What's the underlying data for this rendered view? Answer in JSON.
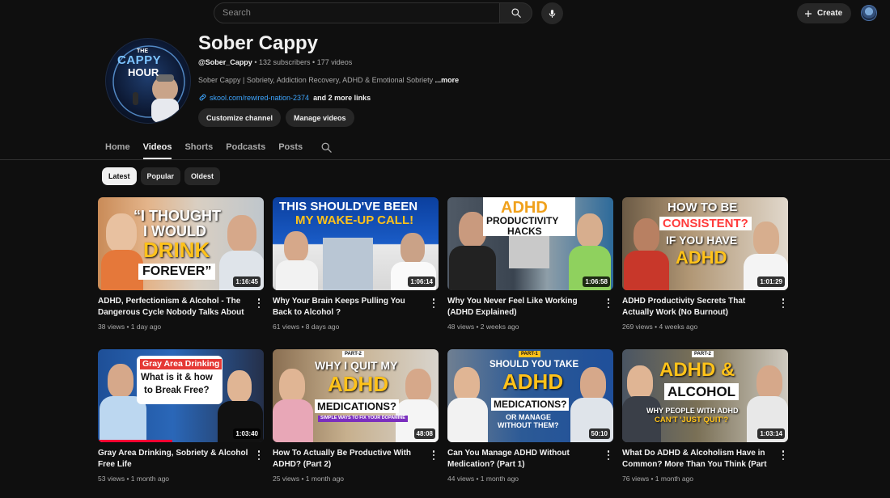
{
  "search": {
    "placeholder": "Search"
  },
  "header": {
    "create_label": "Create"
  },
  "channel": {
    "name": "Sober Cappy",
    "handle": "@Sober_Cappy",
    "subscribers": "132 subscribers",
    "videos_count": "177 videos",
    "description": "Sober Cappy | Sobriety, Addiction Recovery, ADHD & Emotional Sobriety",
    "description_more": "...more",
    "link": "skool.com/rewired-nation-2374",
    "more_links": "and 2 more links",
    "customize_label": "Customize channel",
    "manage_label": "Manage videos",
    "avatar_text": [
      "THE",
      "CAPPY",
      "HOUR"
    ]
  },
  "tabs": [
    "Home",
    "Videos",
    "Shorts",
    "Podcasts",
    "Posts"
  ],
  "active_tab": "Videos",
  "filters": [
    "Latest",
    "Popular",
    "Oldest"
  ],
  "active_filter": "Latest",
  "colors": {
    "accent_red": "#ff0033",
    "link_blue": "#3ea6ff",
    "background": "#0f0f0f"
  },
  "videos": [
    {
      "title": "ADHD, Perfectionism & Alcohol - The Dangerous Cycle Nobody Talks About",
      "views": "38 views",
      "age": "1 day ago",
      "duration": "1:16:45",
      "thumb_text": [
        "“I THOUGHT",
        "I WOULD",
        "DRINK",
        "FOREVER”"
      ]
    },
    {
      "title": "Why Your Brain Keeps Pulling You Back to Alcohol ?",
      "views": "61 views",
      "age": "8 days ago",
      "duration": "1:06:14",
      "thumb_text": [
        "THIS SHOULD'VE BEEN",
        "MY WAKE-UP CALL!"
      ]
    },
    {
      "title": "Why You Never Feel Like Working (ADHD Explained)",
      "views": "48 views",
      "age": "2 weeks ago",
      "duration": "1:06:58",
      "thumb_text": [
        "ADHD",
        "PRODUCTIVITY",
        "HACKS"
      ]
    },
    {
      "title": "ADHD Productivity Secrets That Actually Work (No Burnout)",
      "views": "269 views",
      "age": "4 weeks ago",
      "duration": "1:01:29",
      "thumb_text": [
        "HOW TO BE",
        "CONSISTENT?",
        "IF YOU HAVE",
        "ADHD"
      ]
    },
    {
      "title": "Gray Area Drinking, Sobriety & Alcohol Free Life",
      "views": "53 views",
      "age": "1 month ago",
      "duration": "1:03:40",
      "thumb_text": [
        "Gray Area Drinking",
        "What is it & how",
        "to Break Free?"
      ]
    },
    {
      "title": "How To Actually Be Productive With ADHD? (Part 2)",
      "views": "25 views",
      "age": "1 month ago",
      "duration": "48:08",
      "thumb_text": [
        "PART-2",
        "WHY I QUIT MY",
        "ADHD",
        "MEDICATIONS?",
        "SIMPLE WAYS TO FIX YOUR DOPAMINE"
      ]
    },
    {
      "title": "Can You Manage ADHD Without Medication? (Part 1)",
      "views": "44 views",
      "age": "1 month ago",
      "duration": "50:10",
      "thumb_text": [
        "PART-1",
        "SHOULD YOU TAKE",
        "ADHD",
        "MEDICATIONS?",
        "OR MANAGE",
        "WITHOUT THEM?"
      ]
    },
    {
      "title": "What Do ADHD & Alcoholism Have in Common? More Than You Think (Part ...",
      "views": "76 views",
      "age": "1 month ago",
      "duration": "1:03:14",
      "thumb_text": [
        "PART-2",
        "ADHD &",
        "ALCOHOL",
        "WHY PEOPLE WITH ADHD",
        "CAN'T 'JUST QUIT'?"
      ]
    }
  ]
}
